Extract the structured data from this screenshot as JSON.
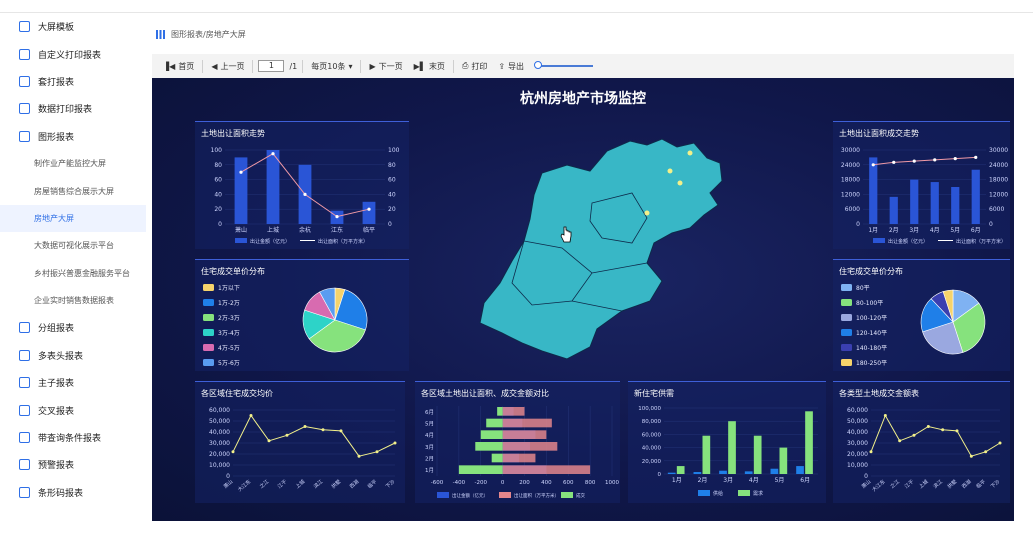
{
  "sidebar": {
    "items": [
      {
        "label": "大屏模板",
        "level": "top",
        "icon": "monitor-icon"
      },
      {
        "label": "自定义打印报表",
        "level": "top",
        "icon": "print-icon"
      },
      {
        "label": "套打报表",
        "level": "top",
        "icon": "layers-icon"
      },
      {
        "label": "数据打印报表",
        "level": "top",
        "icon": "database-icon"
      },
      {
        "label": "图形报表",
        "level": "top",
        "icon": "chart-icon"
      },
      {
        "label": "制作业产能监控大屏",
        "level": "sub"
      },
      {
        "label": "房屋销售综合展示大屏",
        "level": "sub"
      },
      {
        "label": "房地产大屏",
        "level": "sub",
        "active": true
      },
      {
        "label": "大数据可视化展示平台",
        "level": "sub"
      },
      {
        "label": "乡村振兴普惠金融服务平台",
        "level": "sub"
      },
      {
        "label": "企业实时销售数据报表",
        "level": "sub"
      },
      {
        "label": "分组报表",
        "level": "top",
        "icon": "group-icon"
      },
      {
        "label": "多表头报表",
        "level": "top",
        "icon": "table-icon"
      },
      {
        "label": "主子报表",
        "level": "top",
        "icon": "tree-icon"
      },
      {
        "label": "交叉报表",
        "level": "top",
        "icon": "cross-icon"
      },
      {
        "label": "带查询条件报表",
        "level": "top",
        "icon": "search-icon"
      },
      {
        "label": "预警报表",
        "level": "top",
        "icon": "alert-icon"
      },
      {
        "label": "条形码报表",
        "level": "top",
        "icon": "barcode-icon"
      }
    ]
  },
  "breadcrumb": "图形报表/房地产大屏",
  "toolbar": {
    "first": "首页",
    "prev": "上一页",
    "page": "1",
    "total": "/1",
    "per_page": "每页10条",
    "next": "下一页",
    "last": "末页",
    "print": "打印",
    "export": "导出"
  },
  "report": {
    "title": "杭州房地产市场监控"
  },
  "chart_data": [
    {
      "id": "land-area",
      "type": "bar+line",
      "title": "土地出让面积走势",
      "categories": [
        "萧山",
        "上城",
        "余杭",
        "江东",
        "临平"
      ],
      "bars": [
        90,
        100,
        80,
        18,
        30
      ],
      "line": [
        70,
        95,
        40,
        10,
        20
      ],
      "ylim": [
        0,
        100
      ],
      "y2lim": [
        0,
        100
      ],
      "legend": [
        "出让金额（亿元）",
        "出让面积（万平方米）"
      ]
    },
    {
      "id": "land-deal",
      "type": "bar+line",
      "title": "土地出让面积成交走势",
      "categories": [
        "1月",
        "2月",
        "3月",
        "4月",
        "5月",
        "6月"
      ],
      "bars": [
        27000,
        11000,
        18000,
        17000,
        15000,
        22000
      ],
      "line": [
        24000,
        25000,
        25500,
        26000,
        26500,
        27000
      ],
      "ylim": [
        0,
        30000
      ],
      "legend": [
        "出让金额（亿元）",
        "出让面积（万平方米）"
      ]
    },
    {
      "id": "price-dist-left",
      "type": "pie",
      "title": "住宅成交单价分布",
      "legend": [
        "1万以下",
        "1万-2万",
        "2万-3万",
        "3万-4万",
        "4万-5万",
        "5万-6万"
      ],
      "values": [
        5,
        25,
        35,
        15,
        12,
        8
      ],
      "colors": [
        "#f6d36b",
        "#1f7fe8",
        "#86e27d",
        "#2dd3c8",
        "#d86bb0",
        "#5a9cf0"
      ]
    },
    {
      "id": "price-dist-right",
      "type": "pie",
      "title": "住宅成交单价分布",
      "legend": [
        "80平",
        "80-100平",
        "100-120平",
        "120-140平",
        "140-180平",
        "180-250平"
      ],
      "values": [
        15,
        30,
        25,
        18,
        7,
        5
      ],
      "colors": [
        "#7fb2f2",
        "#86e27d",
        "#9aa8e0",
        "#1f7fe8",
        "#3a3fb0",
        "#f6d36b"
      ]
    },
    {
      "id": "district-price",
      "type": "line",
      "title": "各区域住宅成交均价",
      "categories": [
        "萧山",
        "大江东",
        "之江",
        "江干",
        "上城",
        "滨江",
        "拱墅",
        "西湖",
        "临平",
        "下沙"
      ],
      "values": [
        22000,
        55000,
        32000,
        37000,
        45000,
        42000,
        41000,
        18000,
        22000,
        30000
      ],
      "ylim": [
        0,
        60000
      ]
    },
    {
      "id": "district-land",
      "type": "bar",
      "title": "各区域土地出让面积、成交金额对比",
      "categories": [
        "1月",
        "2月",
        "3月",
        "4月",
        "5月",
        "6月"
      ],
      "xlim": [
        -600,
        1000
      ],
      "series": [
        {
          "name": "出让金额（亿元）",
          "values": [
            400,
            150,
            250,
            300,
            180,
            100
          ]
        },
        {
          "name": "出让面积（万平方米）",
          "values": [
            800,
            300,
            500,
            400,
            450,
            200
          ]
        },
        {
          "name": "成交",
          "values": [
            -400,
            -100,
            -250,
            -200,
            -150,
            -50
          ]
        }
      ]
    },
    {
      "id": "new-supply",
      "type": "bar",
      "title": "新住宅供需",
      "categories": [
        "1月",
        "2月",
        "3月",
        "4月",
        "5月",
        "6月"
      ],
      "series": [
        {
          "name": "供给",
          "values": [
            2000,
            3000,
            5000,
            4000,
            8000,
            12000
          ]
        },
        {
          "name": "需求",
          "values": [
            12000,
            58000,
            80000,
            58000,
            40000,
            95000
          ]
        }
      ],
      "ylim": [
        0,
        100000
      ]
    },
    {
      "id": "land-type",
      "type": "line",
      "title": "各类型土地成交金额表",
      "categories": [
        "萧山",
        "大江东",
        "之江",
        "江干",
        "上城",
        "滨江",
        "拱墅",
        "西湖",
        "临平",
        "下沙"
      ],
      "values": [
        22000,
        55000,
        32000,
        37000,
        45000,
        42000,
        41000,
        18000,
        22000,
        30000
      ],
      "ylim": [
        0,
        60000
      ]
    }
  ]
}
